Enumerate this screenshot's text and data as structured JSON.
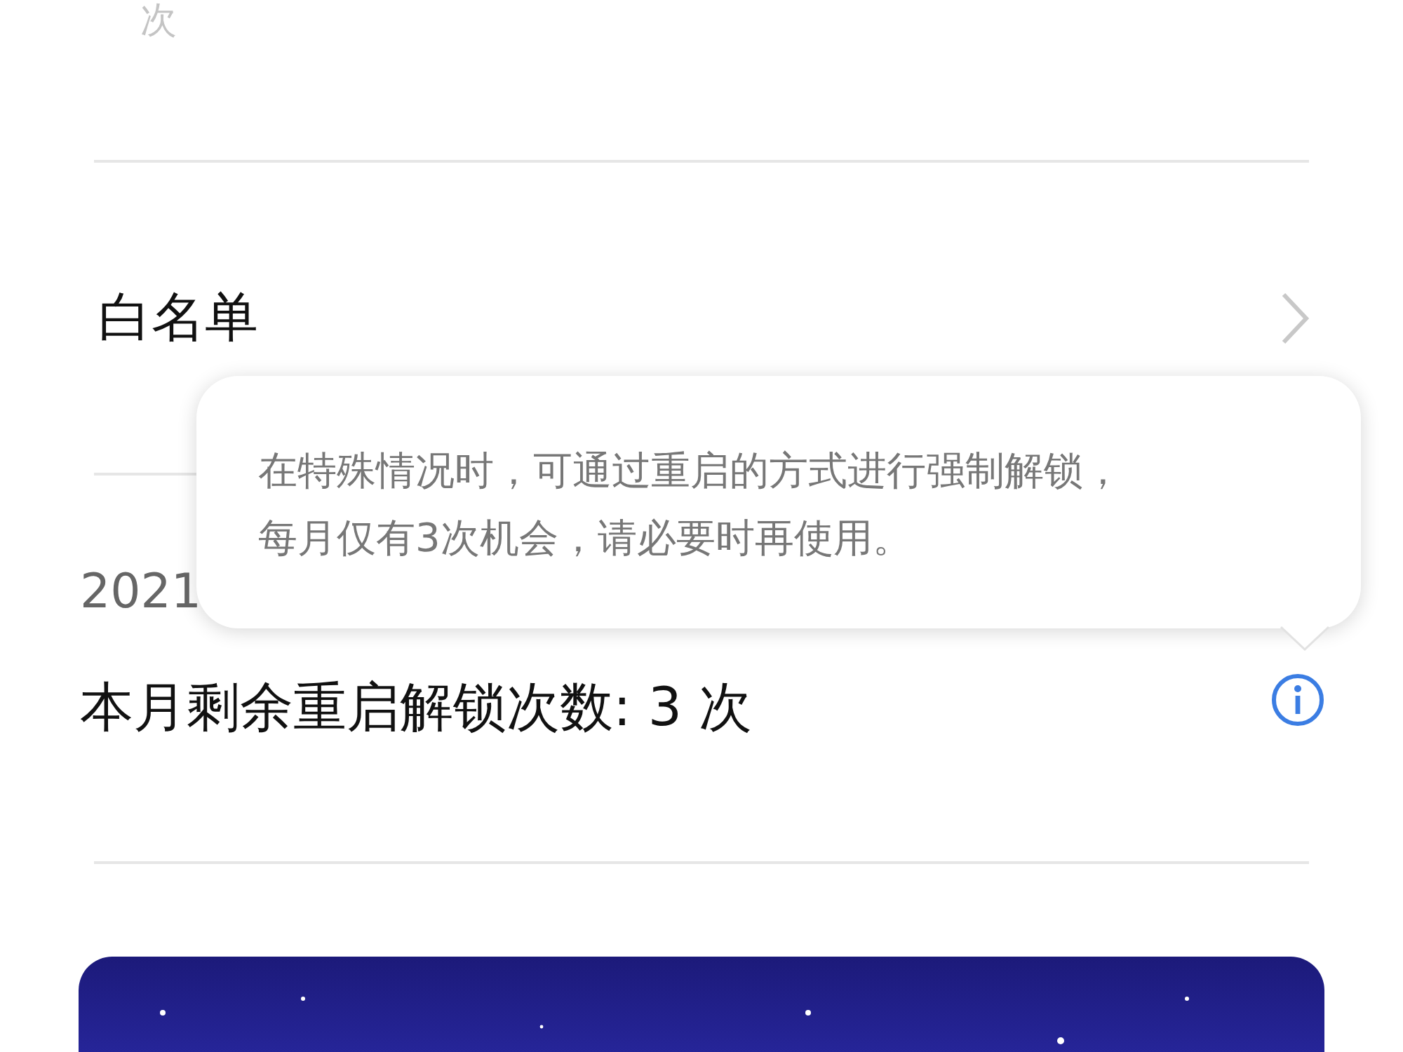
{
  "top_fragment": "次",
  "whitelist": {
    "label": "白名单"
  },
  "date_fragment": "2021",
  "unlock_count": {
    "label": "本月剩余重启解锁次数: 3 次"
  },
  "tooltip": {
    "lines": [
      "在特殊情况时，可通过重启的方式进行强制解锁，",
      "每月仅有3次机会，请必要时再使用。"
    ]
  }
}
